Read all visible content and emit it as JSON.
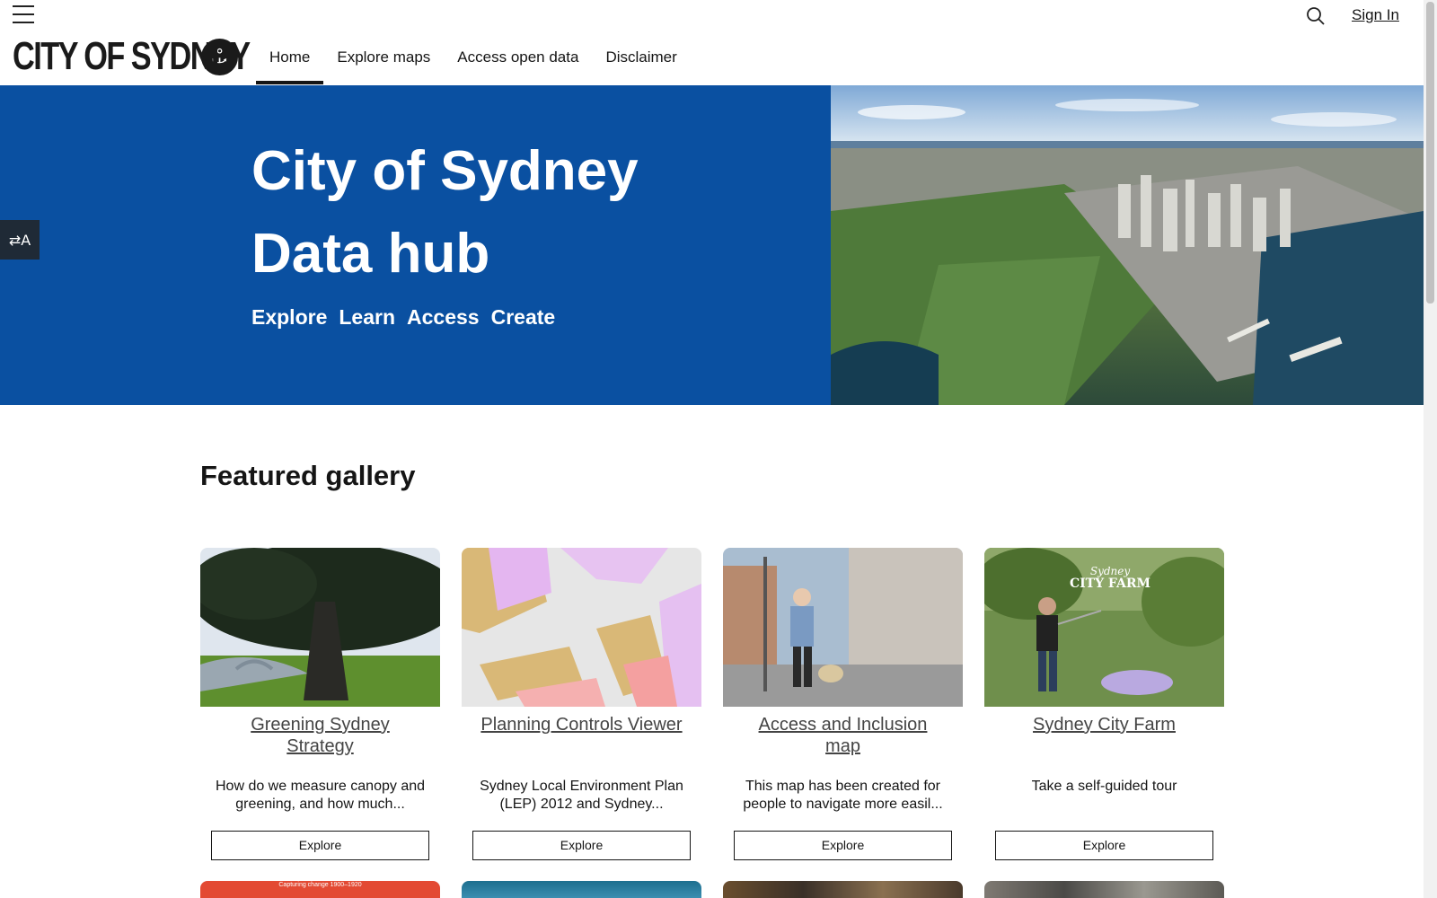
{
  "header": {
    "logo_text": "CITY OF SYDNEY",
    "nav": [
      {
        "label": "Home",
        "active": true
      },
      {
        "label": "Explore maps",
        "active": false
      },
      {
        "label": "Access open data",
        "active": false
      },
      {
        "label": "Disclaimer",
        "active": false
      }
    ],
    "signin_label": "Sign In"
  },
  "hero": {
    "title_line1": "City of Sydney",
    "title_line2": "Data hub",
    "links": [
      "Explore",
      "Learn",
      "Access",
      "Create"
    ],
    "bg_color": "#0a50a1"
  },
  "gallery": {
    "title": "Featured gallery",
    "cards": [
      {
        "title": "Greening Sydney Strategy",
        "desc": "How do we measure canopy and greening, and how much...",
        "button": "Explore"
      },
      {
        "title": "Planning Controls Viewer",
        "desc": "Sydney Local Environment Plan (LEP) 2012 and Sydney...",
        "button": "Explore"
      },
      {
        "title": "Access and Inclusion map",
        "desc": "This map has been created for people to navigate more easil...",
        "button": "Explore"
      },
      {
        "title": "Sydney City Farm",
        "desc": "Take a self-guided tour",
        "button": "Explore"
      }
    ],
    "next_row_caption": "Capturing change 1900–1920",
    "farm_badge_line1": "Sydney",
    "farm_badge_line2": "CITY FARM"
  }
}
